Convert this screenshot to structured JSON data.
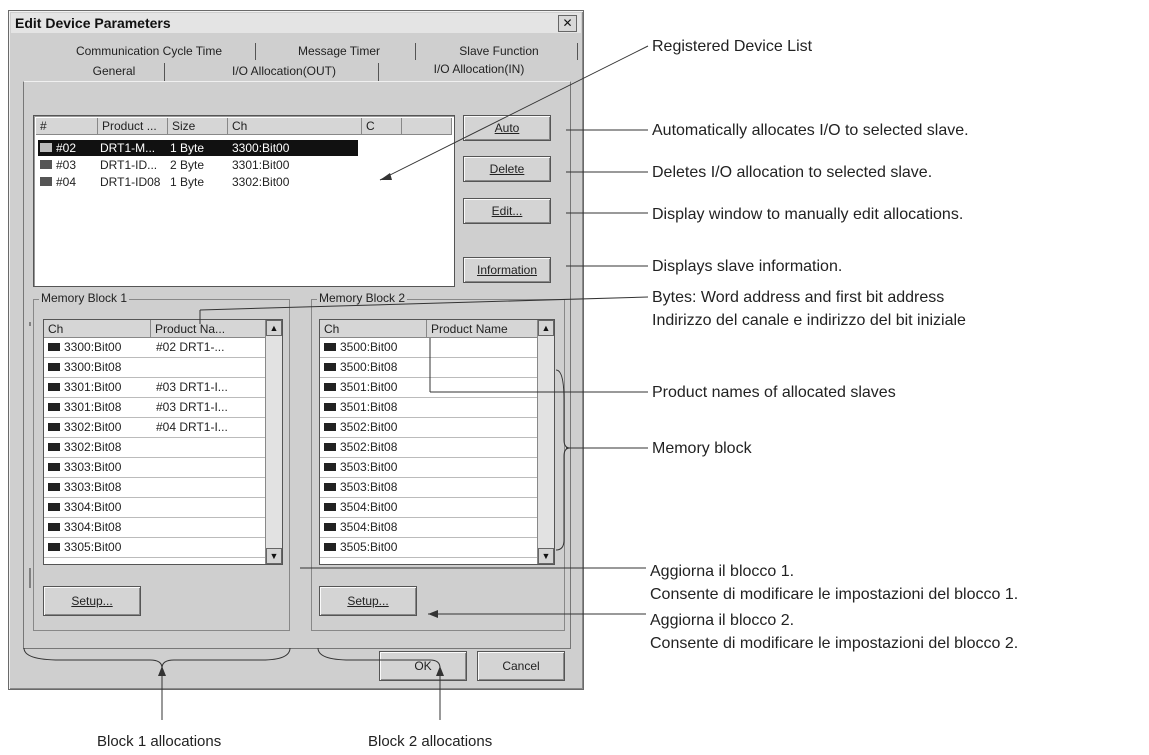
{
  "dialog": {
    "title": "Edit Device Parameters",
    "close_glyph": "✕",
    "tabs_row1": [
      "Communication Cycle Time",
      "Message Timer",
      "Slave Function"
    ],
    "tabs_row2": [
      "General",
      "I/O Allocation(OUT)",
      "I/O Allocation(IN)"
    ]
  },
  "device_list": {
    "columns": [
      "#",
      "Product ...",
      "Size",
      "Ch",
      "C"
    ],
    "rows": [
      {
        "num": "#02",
        "product": "DRT1-M...",
        "size": "1 Byte",
        "ch": "3300:Bit00"
      },
      {
        "num": "#03",
        "product": "DRT1-ID...",
        "size": "2 Byte",
        "ch": "3301:Bit00"
      },
      {
        "num": "#04",
        "product": "DRT1-ID08",
        "size": "1 Byte",
        "ch": "3302:Bit00"
      }
    ]
  },
  "buttons": {
    "auto": "Auto",
    "delete": "Delete",
    "edit": "Edit...",
    "information": "Information",
    "setup1": "Setup...",
    "setup2": "Setup...",
    "ok": "OK",
    "cancel": "Cancel"
  },
  "block1": {
    "label": "Memory Block 1",
    "col_ch": "Ch",
    "col_product": "Product Na...",
    "rows": [
      {
        "ch": "3300:Bit00",
        "product": "#02 DRT1-..."
      },
      {
        "ch": "3300:Bit08",
        "product": ""
      },
      {
        "ch": "3301:Bit00",
        "product": "#03 DRT1-I..."
      },
      {
        "ch": "3301:Bit08",
        "product": "#03 DRT1-I..."
      },
      {
        "ch": "3302:Bit00",
        "product": "#04 DRT1-I..."
      },
      {
        "ch": "3302:Bit08",
        "product": ""
      },
      {
        "ch": "3303:Bit00",
        "product": ""
      },
      {
        "ch": "3303:Bit08",
        "product": ""
      },
      {
        "ch": "3304:Bit00",
        "product": ""
      },
      {
        "ch": "3304:Bit08",
        "product": ""
      },
      {
        "ch": "3305:Bit00",
        "product": ""
      }
    ]
  },
  "block2": {
    "label": "Memory Block 2",
    "col_ch": "Ch",
    "col_product": "Product Name",
    "rows": [
      {
        "ch": "3500:Bit00",
        "product": ""
      },
      {
        "ch": "3500:Bit08",
        "product": ""
      },
      {
        "ch": "3501:Bit00",
        "product": ""
      },
      {
        "ch": "3501:Bit08",
        "product": ""
      },
      {
        "ch": "3502:Bit00",
        "product": ""
      },
      {
        "ch": "3502:Bit08",
        "product": ""
      },
      {
        "ch": "3503:Bit00",
        "product": ""
      },
      {
        "ch": "3503:Bit08",
        "product": ""
      },
      {
        "ch": "3504:Bit00",
        "product": ""
      },
      {
        "ch": "3504:Bit08",
        "product": ""
      },
      {
        "ch": "3505:Bit00",
        "product": ""
      }
    ]
  },
  "annotations": {
    "registered_list": "Registered Device List",
    "auto": "Automatically allocates I/O to selected slave.",
    "delete": "Deletes I/O allocation to selected slave.",
    "edit": "Display window to manually edit allocations.",
    "information": "Displays slave information.",
    "bytes_en": "Bytes: Word address and first bit address",
    "bytes_it": "Indirizzo del canale e indirizzo del bit iniziale",
    "product_names": "Product names of allocated slaves",
    "memory_block": "Memory block",
    "setup1_a": "Aggiorna il blocco 1.",
    "setup1_b": "Consente di modificare le impostazioni del blocco 1.",
    "setup2_a": "Aggiorna il blocco 2.",
    "setup2_b": "Consente di modificare le impostazioni del blocco 2.",
    "block1_alloc": "Block 1 allocations",
    "block2_alloc": "Block 2 allocations"
  }
}
